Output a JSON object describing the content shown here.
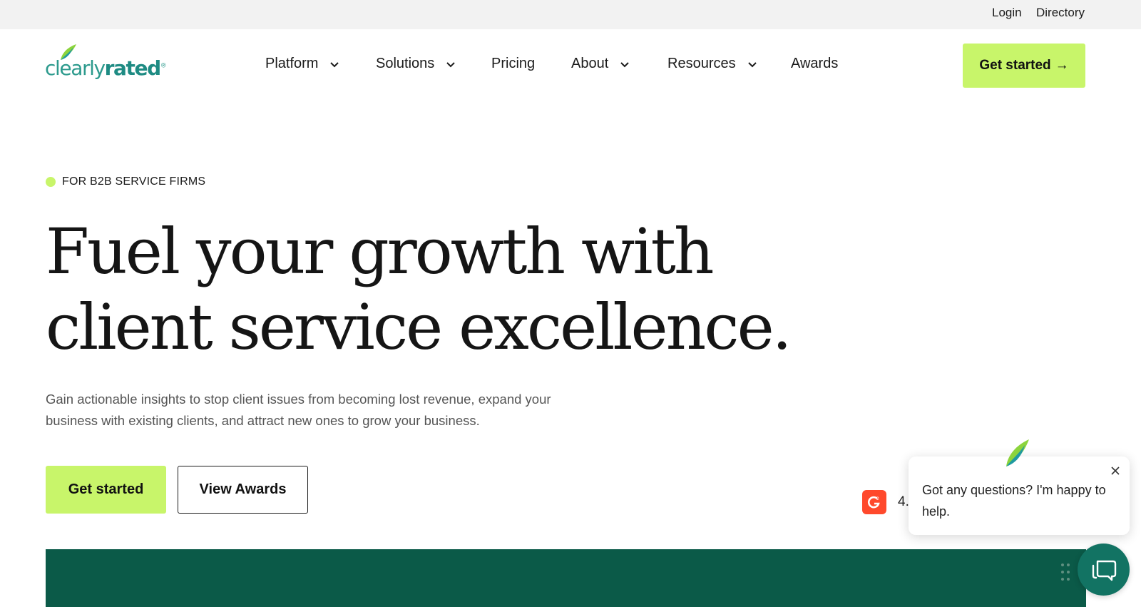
{
  "utility_nav": {
    "login": "Login",
    "directory": "Directory"
  },
  "brand": {
    "name_light": "clearly",
    "name_bold": "rated",
    "registered": "®"
  },
  "nav": {
    "items": [
      {
        "label": "Platform",
        "has_dropdown": true
      },
      {
        "label": "Solutions",
        "has_dropdown": true
      },
      {
        "label": "Pricing",
        "has_dropdown": false
      },
      {
        "label": "About",
        "has_dropdown": true
      },
      {
        "label": "Resources",
        "has_dropdown": true
      },
      {
        "label": "Awards",
        "has_dropdown": false
      }
    ],
    "cta_label": "Get started",
    "cta_arrow": "→"
  },
  "hero": {
    "eyebrow": "FOR B2B SERVICE FIRMS",
    "headline_line1": "Fuel your growth with",
    "headline_line2": "client service excellence.",
    "subtext": "Gain actionable insights to stop client issues from becoming lost revenue, expand your business with existing clients, and attract new ones to grow your business.",
    "primary_button": "Get started",
    "secondary_button": "View Awards"
  },
  "rating": {
    "badge": "G2",
    "score_partial": "4."
  },
  "chat": {
    "message": "Got any questions? I'm happy to help.",
    "launcher_icon": "chat-bubbles-icon",
    "close_icon": "close-icon"
  },
  "colors": {
    "accent_lime": "#c8f56a",
    "brand_teal": "#2c9a8d",
    "banner_green": "#0b5a48",
    "chat_green": "#127363",
    "g2_red": "#ff492c",
    "utility_bar": "#f2f2f2"
  }
}
